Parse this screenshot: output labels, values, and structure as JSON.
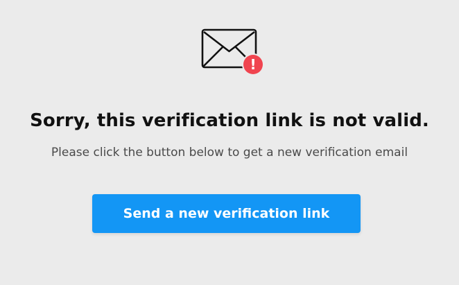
{
  "icon": {
    "envelope": "envelope-icon",
    "alert": "alert-icon",
    "alert_glyph": "!",
    "alert_color": "#f0444f"
  },
  "title": "Sorry, this verification link is not valid.",
  "subtitle": "Please click the button below to get a new verification email",
  "button": {
    "label": "Send a new verification link",
    "color": "#1396f5"
  }
}
